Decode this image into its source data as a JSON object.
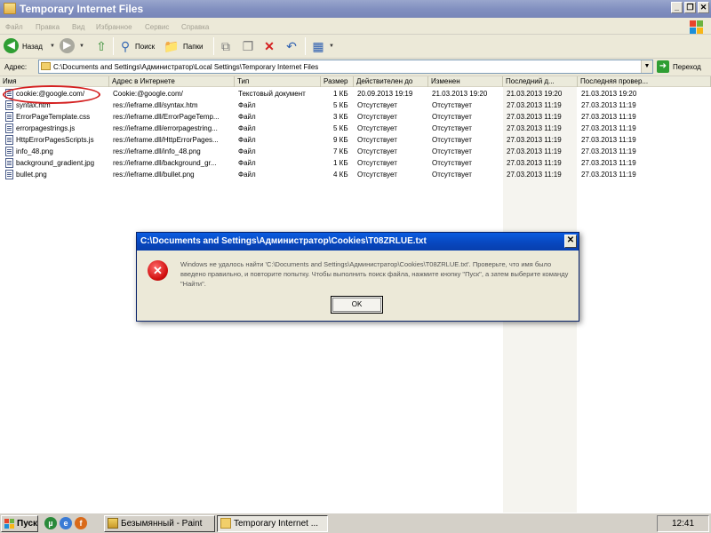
{
  "window": {
    "title": "Temporary Internet Files",
    "minimize": "_",
    "restore": "❐",
    "close": "✕"
  },
  "menu": [
    "Файл",
    "Правка",
    "Вид",
    "Избранное",
    "Сервис",
    "Справка"
  ],
  "toolbar": {
    "back_label": "Назад",
    "search_label": "Поиск",
    "folders_label": "Папки"
  },
  "address": {
    "label": "Адрес:",
    "path": "C:\\Documents and Settings\\Администратор\\Local Settings\\Temporary Internet Files",
    "go_label": "Переход"
  },
  "list": {
    "columns": [
      "Имя",
      "Адрес в Интернете",
      "Тип",
      "Размер",
      "Действителен до",
      "Изменен",
      "Последний д...",
      "Последняя провер..."
    ],
    "rows": [
      [
        "cookie:@google.com/",
        "Cookie:@google.com/",
        "Текстовый документ",
        "1 КБ",
        "20.09.2013 19:19",
        "21.03.2013 19:20",
        "21.03.2013 19:20",
        "21.03.2013 19:20"
      ],
      [
        "syntax.htm",
        "res://ieframe.dll/syntax.htm",
        "Файл",
        "5 КБ",
        "Отсутствует",
        "Отсутствует",
        "27.03.2013 11:19",
        "27.03.2013 11:19"
      ],
      [
        "ErrorPageTemplate.css",
        "res://ieframe.dll/ErrorPageTemp...",
        "Файл",
        "3 КБ",
        "Отсутствует",
        "Отсутствует",
        "27.03.2013 11:19",
        "27.03.2013 11:19"
      ],
      [
        "errorpagestrings.js",
        "res://ieframe.dll/errorpagestring...",
        "Файл",
        "5 КБ",
        "Отсутствует",
        "Отсутствует",
        "27.03.2013 11:19",
        "27.03.2013 11:19"
      ],
      [
        "HttpErrorPagesScripts.js",
        "res://ieframe.dll/HttpErrorPages...",
        "Файл",
        "9 КБ",
        "Отсутствует",
        "Отсутствует",
        "27.03.2013 11:19",
        "27.03.2013 11:19"
      ],
      [
        "info_48.png",
        "res://ieframe.dll/info_48.png",
        "Файл",
        "7 КБ",
        "Отсутствует",
        "Отсутствует",
        "27.03.2013 11:19",
        "27.03.2013 11:19"
      ],
      [
        "background_gradient.jpg",
        "res://ieframe.dll/background_gr...",
        "Файл",
        "1 КБ",
        "Отсутствует",
        "Отсутствует",
        "27.03.2013 11:19",
        "27.03.2013 11:19"
      ],
      [
        "bullet.png",
        "res://ieframe.dll/bullet.png",
        "Файл",
        "4 КБ",
        "Отсутствует",
        "Отсутствует",
        "27.03.2013 11:19",
        "27.03.2013 11:19"
      ]
    ]
  },
  "dialog": {
    "title": "C:\\Documents and Settings\\Администратор\\Cookies\\T08ZRLUE.txt",
    "message": "Windows не удалось найти 'C:\\Documents and Settings\\Администратор\\Cookies\\T08ZRLUE.txt'. Проверьте, что имя было введено правильно, и повторите попытку. Чтобы выполнить поиск файла, нажмите кнопку \"Пуск\", а затем выберите команду \"Найти\".",
    "ok_label": "OK",
    "close_glyph": "✕"
  },
  "taskbar": {
    "start_label": "Пуск",
    "tasks": [
      "Безымянный - Paint",
      "Temporary Internet ..."
    ],
    "clock": "12:41"
  },
  "colors": {
    "annotation_red": "#d42020",
    "dialog_title_blue": "#0846bd",
    "titlebar_inactive": "#8290c0"
  }
}
